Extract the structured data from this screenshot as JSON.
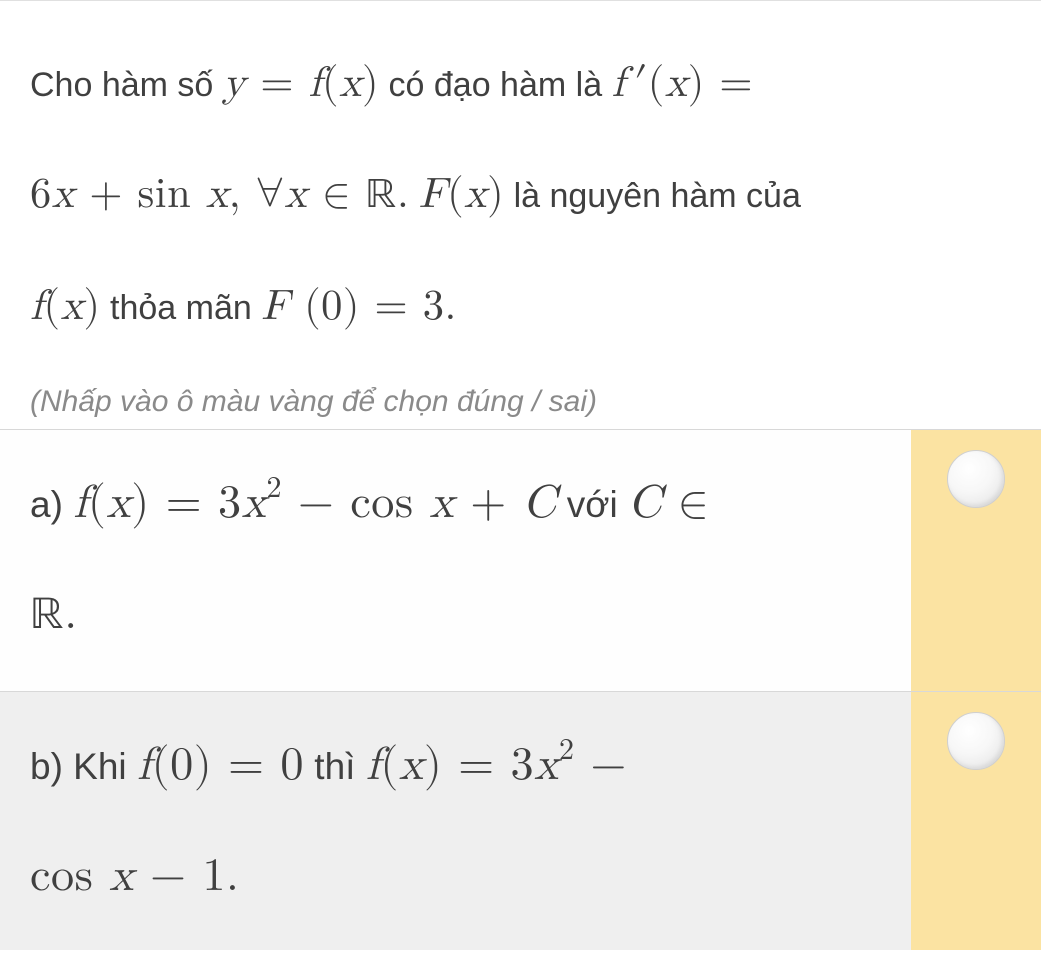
{
  "question": {
    "line1_pre": "Cho hàm số ",
    "line1_m1": "y = f(x)",
    "line1_mid": " có đạo hàm là ",
    "line1_m2": "f′(x) =",
    "line2_m1": "6x + sin x, ∀x ∈ ℝ.",
    "line2_mid1": " ",
    "line2_m2": "F(x)",
    "line2_mid2": " là nguyên hàm của",
    "line3_m1": "f(x)",
    "line3_mid": " thỏa mãn ",
    "line3_m2": "F (0) = 3.",
    "line3_end": ""
  },
  "instruction": "(Nhấp vào ô màu vàng để chọn đúng / sai)",
  "answers": {
    "a": {
      "label": "a) ",
      "m1": "f(x) = 3x² − cos x + C",
      "mid": " với ",
      "m2": "C ∈",
      "line2": "ℝ.",
      "line2_end": ""
    },
    "b": {
      "label": "b) Khi ",
      "m1": "f(0) = 0",
      "mid": " thì ",
      "m2": "f(x) = 3x² −",
      "line2": "cos x − 1.",
      "line2_end": ""
    }
  }
}
